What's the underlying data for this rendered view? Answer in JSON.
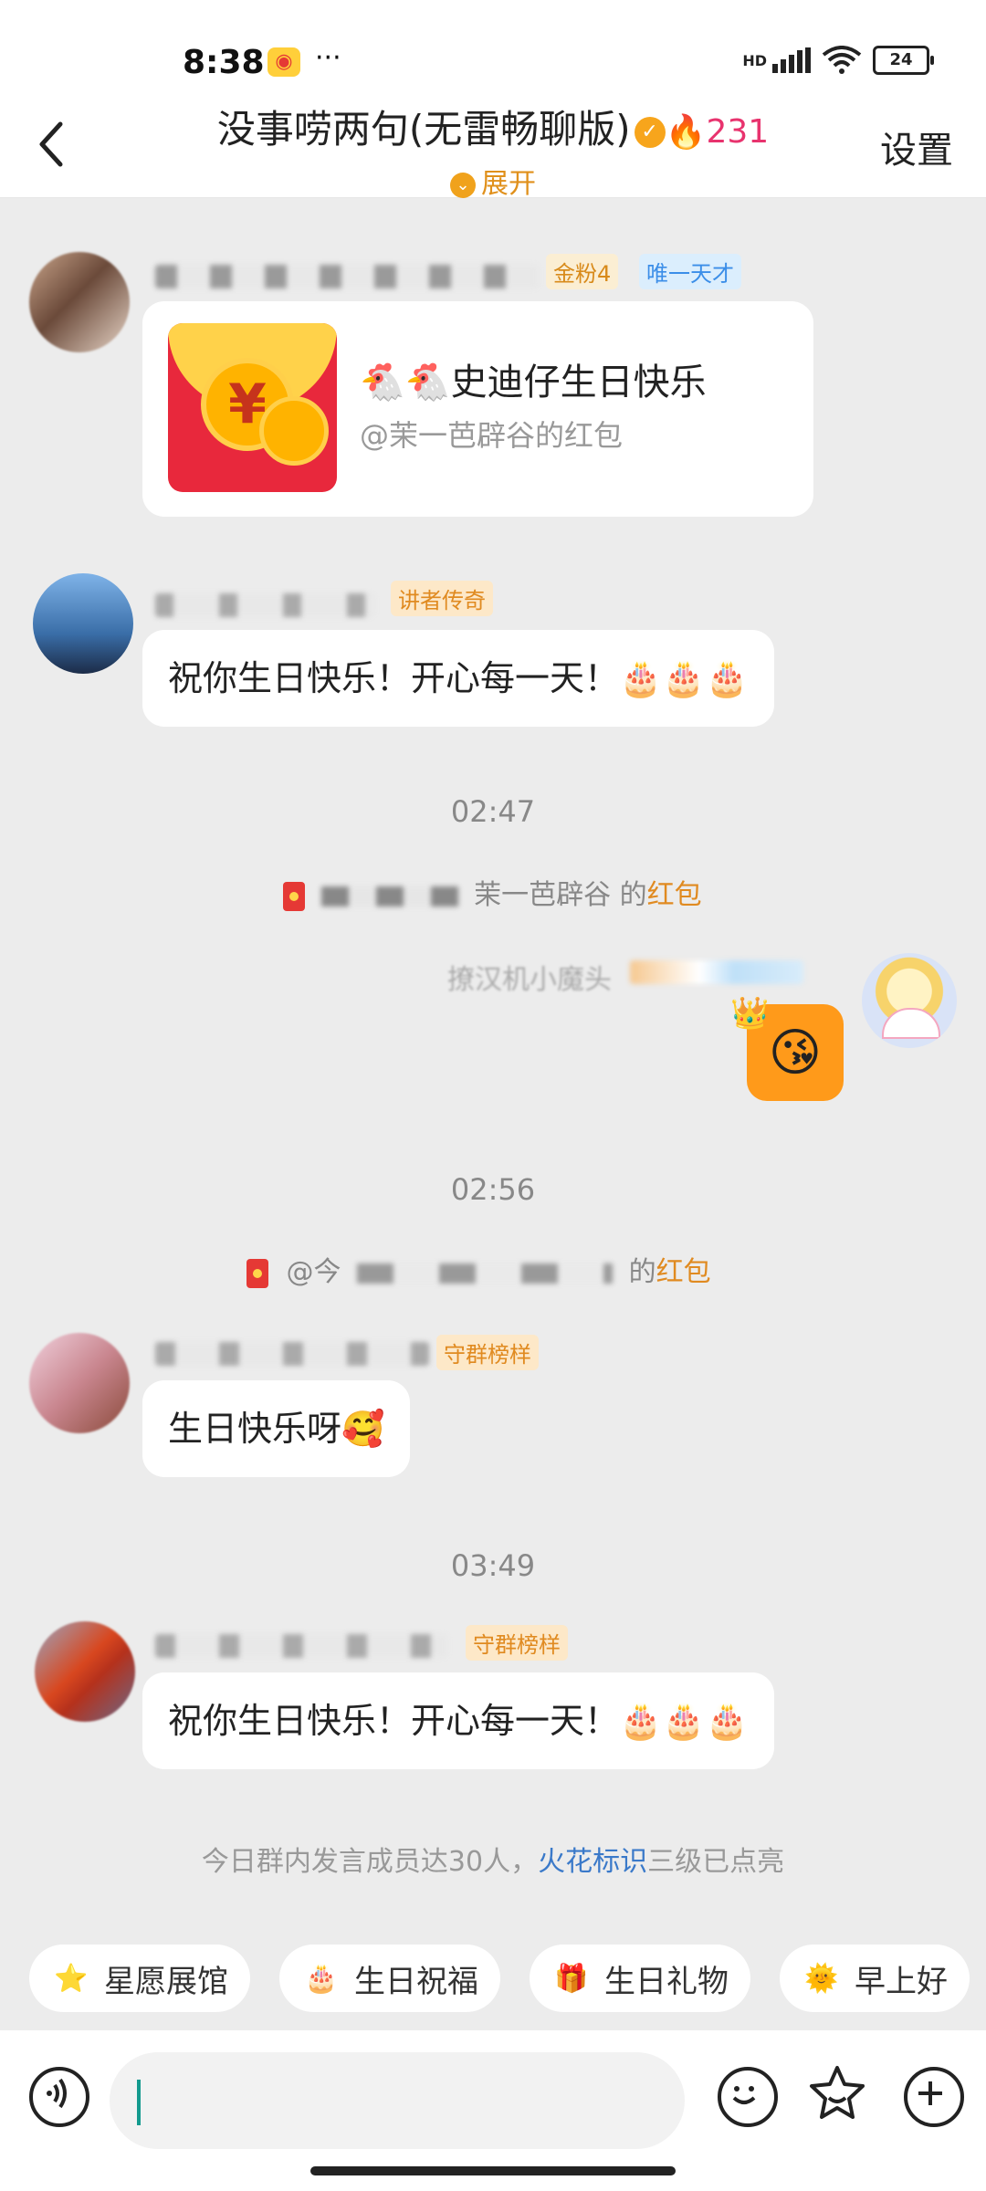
{
  "status_bar": {
    "time": "8:38",
    "app_icon": "weibo-icon",
    "dots": "···",
    "network": "HD",
    "battery": "24"
  },
  "header": {
    "title": "没事唠两句(无雷畅聊版)",
    "hot_count": "231",
    "expand_label": "展开",
    "settings_label": "设置"
  },
  "messages": [
    {
      "badges": [
        "金粉4",
        "唯一天才"
      ],
      "type": "red_packet",
      "packet_title": "🐔🐔史迪仔生日快乐",
      "packet_sub": "@茉一芭辟谷的红包"
    },
    {
      "badges": [
        "讲者传奇"
      ],
      "type": "text",
      "text": "祝你生日快乐！开心每一天！🎂🎂🎂"
    },
    {
      "time": "02:47"
    },
    {
      "system": "茉一芭辟谷 的",
      "link": "红包"
    },
    {
      "self_name": "撩汉机小魔头",
      "type": "sticker",
      "sticker": "😘"
    },
    {
      "time": "02:56"
    },
    {
      "system": "@今",
      "system_tail": "的",
      "link": "红包"
    },
    {
      "badges": [
        "守群榜样"
      ],
      "type": "text",
      "text": "生日快乐呀🥰"
    },
    {
      "time": "03:49"
    },
    {
      "badges": [
        "守群榜样"
      ],
      "type": "text",
      "text": "祝你生日快乐！开心每一天！🎂🎂🎂"
    }
  ],
  "notice": {
    "prefix": "今日群内发言成员达30人，",
    "link": "火花标识",
    "suffix": "三级已点亮"
  },
  "quick_actions": [
    {
      "label": "星愿展馆",
      "icon": "⭐"
    },
    {
      "label": "生日祝福",
      "icon": "🎂"
    },
    {
      "label": "生日礼物",
      "icon": "🎁"
    },
    {
      "label": "早上好",
      "icon": "🌞"
    }
  ],
  "input": {
    "placeholder": ""
  }
}
